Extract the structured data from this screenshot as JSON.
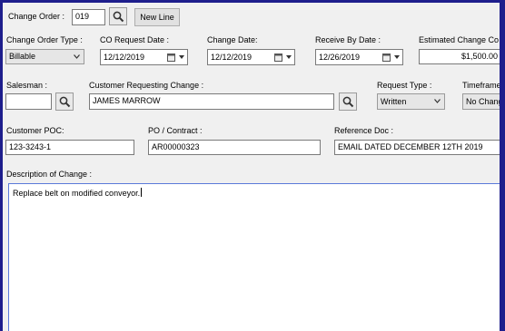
{
  "header": {
    "change_order_label": "Change Order :",
    "change_order_value": "019",
    "new_line_label": "New Line"
  },
  "row1": {
    "type_label": "Change Order Type :",
    "type_value": "Billable",
    "co_request_label": "CO Request Date :",
    "co_request_value": "12/12/2019",
    "change_date_label": "Change Date:",
    "change_date_value": "12/12/2019",
    "receive_by_label": "Receive By Date :",
    "receive_by_value": "12/26/2019",
    "estimated_label": "Estimated Change Co",
    "estimated_value": "$1,500.00"
  },
  "row2": {
    "salesman_label": "Salesman :",
    "salesman_value": "",
    "customer_req_label": "Customer Requesting Change :",
    "customer_req_value": "JAMES MARROW",
    "request_type_label": "Request Type :",
    "request_type_value": "Written",
    "timeframe_label": "Timeframe",
    "timeframe_value": "No Chang"
  },
  "row3": {
    "poc_label": "Customer POC:",
    "poc_value": "123-3243-1",
    "po_label": "PO / Contract :",
    "po_value": "AR00000323",
    "ref_label": "Reference Doc :",
    "ref_value": "EMAIL DATED DECEMBER 12TH 2019"
  },
  "description": {
    "label": "Description of Change :",
    "value": "Replace belt on modified conveyor."
  }
}
